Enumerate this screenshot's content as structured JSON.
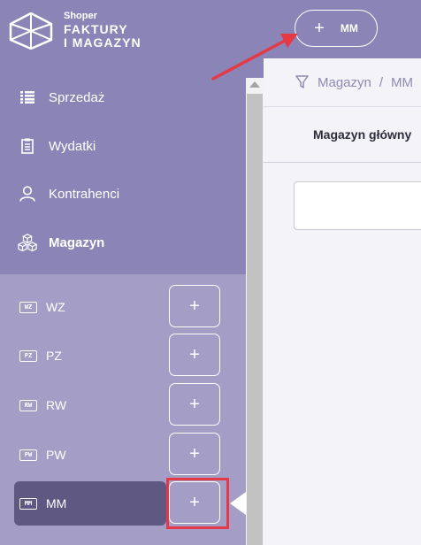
{
  "brand": {
    "small": "Shoper",
    "line1": "FAKTURY",
    "line2": "I MAGAZYN"
  },
  "nav": {
    "sales": "Sprzedaż",
    "expenses": "Wydatki",
    "contractors": "Kontrahenci",
    "warehouse": "Magazyn"
  },
  "submenu": [
    {
      "code": "WZ",
      "label": "WZ",
      "add": "+"
    },
    {
      "code": "PZ",
      "label": "PZ",
      "add": "+"
    },
    {
      "code": "RW",
      "label": "RW",
      "add": "+"
    },
    {
      "code": "PW",
      "label": "PW",
      "add": "+"
    },
    {
      "code": "MM",
      "label": "MM",
      "add": "+"
    }
  ],
  "topbar": {
    "plus": "+",
    "label": "MM"
  },
  "breadcrumb": {
    "first": "Magazyn",
    "separator": "/",
    "second": "MM"
  },
  "tabs": {
    "main_warehouse": "Magazyn główny"
  },
  "colors": {
    "sidebar": "#8b84b6",
    "submenu": "#a49dc6",
    "active_item": "#5f5882",
    "highlight": "#e53946",
    "annotation_arrow": "#e53946"
  },
  "icons": {
    "logo": "hexagon-cube-logo",
    "sales": "list-icon",
    "expenses": "clipboard-icon",
    "contractors": "user-icon",
    "warehouse": "boxes-icon",
    "filter": "funnel-icon",
    "documents": "document-code-icon"
  }
}
